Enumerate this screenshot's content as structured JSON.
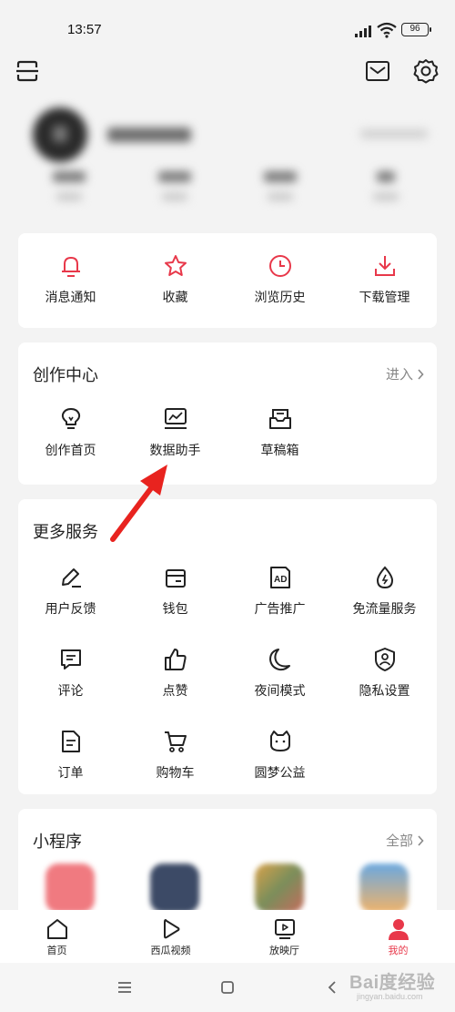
{
  "status_bar": {
    "time": "13:57",
    "battery": "96"
  },
  "top_bar": {
    "scan_icon": "scan-icon",
    "mail_icon": "mail-icon",
    "settings_icon": "gear-icon"
  },
  "quick_actions": [
    {
      "label": "消息通知",
      "icon": "bell-icon"
    },
    {
      "label": "收藏",
      "icon": "star-icon"
    },
    {
      "label": "浏览历史",
      "icon": "clock-icon"
    },
    {
      "label": "下载管理",
      "icon": "download-icon"
    }
  ],
  "creator_center": {
    "title": "创作中心",
    "more_label": "进入",
    "items": [
      {
        "label": "创作首页",
        "icon": "lightbulb-icon"
      },
      {
        "label": "数据助手",
        "icon": "chart-monitor-icon"
      },
      {
        "label": "草稿箱",
        "icon": "draft-box-icon"
      }
    ]
  },
  "more_services": {
    "title": "更多服务",
    "items": [
      {
        "label": "用户反馈",
        "icon": "pencil-icon"
      },
      {
        "label": "钱包",
        "icon": "wallet-icon"
      },
      {
        "label": "广告推广",
        "icon": "ad-icon"
      },
      {
        "label": "免流量服务",
        "icon": "drop-icon"
      },
      {
        "label": "评论",
        "icon": "comment-icon"
      },
      {
        "label": "点赞",
        "icon": "thumbs-up-icon"
      },
      {
        "label": "夜间模式",
        "icon": "moon-icon"
      },
      {
        "label": "隐私设置",
        "icon": "shield-user-icon"
      },
      {
        "label": "订单",
        "icon": "document-icon"
      },
      {
        "label": "购物车",
        "icon": "cart-icon"
      },
      {
        "label": "圆梦公益",
        "icon": "cat-icon"
      }
    ]
  },
  "mini_programs": {
    "title": "小程序",
    "more_label": "全部"
  },
  "tab_bar": {
    "active": "我的",
    "tabs": [
      {
        "label": "首页",
        "icon": "home-icon"
      },
      {
        "label": "西瓜视频",
        "icon": "play-icon"
      },
      {
        "label": "放映厅",
        "icon": "tv-icon"
      },
      {
        "label": "我的",
        "icon": "person-icon"
      }
    ]
  },
  "watermark": {
    "text": "Bai度经验",
    "sub": "jingyan.baidu.com"
  },
  "colors": {
    "accent_red": "#e8384a",
    "background": "#f3f3f3",
    "card": "#ffffff"
  }
}
